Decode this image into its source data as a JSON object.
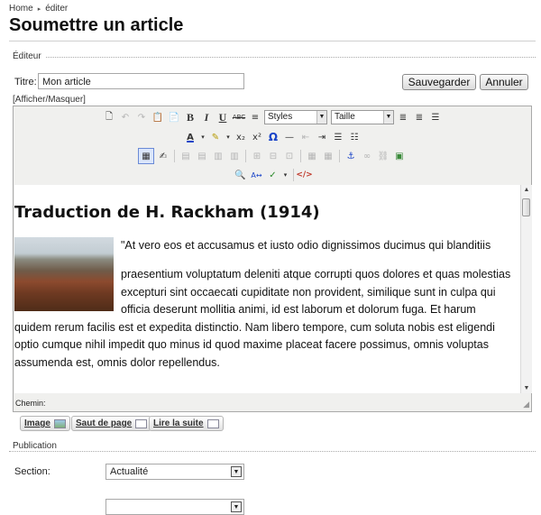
{
  "breadcrumb": {
    "home": "Home",
    "current": "éditer"
  },
  "page_title": "Soumettre un article",
  "editor_section": {
    "legend": "Éditeur",
    "title_label": "Titre:",
    "title_value": "Mon article",
    "save_label": "Sauvegarder",
    "cancel_label": "Annuler",
    "toggle_label": "[Afficher/Masquer]"
  },
  "toolbar": {
    "styles_value": "Styles",
    "size_value": "Taille",
    "icons_row1": [
      "new-document-icon",
      "undo-icon",
      "redo-icon",
      "paste-text-icon",
      "paste-word-icon",
      "bold-icon",
      "italic-icon",
      "underline-icon",
      "strikethrough-icon",
      "align-justify-icon",
      "align-left-icon",
      "align-right-icon",
      "align-full-icon"
    ],
    "icons_row2": [
      "text-color-icon",
      "highlight-color-icon",
      "subscript-icon",
      "superscript-icon",
      "special-character-icon",
      "horizontal-rule-icon",
      "outdent-icon",
      "indent-icon",
      "bullet-list-icon",
      "numbered-list-icon"
    ],
    "icons_row3": [
      "insert-table-icon",
      "table-properties-icon",
      "anchor-icon",
      "link-icon",
      "unlink-icon",
      "insert-image-icon"
    ],
    "icons_row4": [
      "find-icon",
      "replace-icon",
      "spellcheck-icon",
      "html-source-icon"
    ]
  },
  "content": {
    "heading": "Traduction de H. Rackham (1914)",
    "para1": "\"At vero eos et accusamus et iusto odio dignissimos ducimus qui blanditiis",
    "para2_lines": [
      "praesentium voluptatum deleniti atque corrupti quos dolores et quas molestias",
      "excepturi sint occaecati cupiditate non provident, similique sunt in culpa qui",
      "officia deserunt mollitia animi, id est laborum et dolorum fuga. Et harum",
      "quidem rerum facilis est et expedita distinctio. Nam libero tempore, cum soluta nobis est eligendi",
      "optio cumque nihil impedit quo minus id quod maxime placeat facere possimus, omnis voluptas",
      "assumenda est, omnis dolor repellendus."
    ]
  },
  "status_bar": {
    "path_label": "Chemin:"
  },
  "extra_buttons": {
    "image": "Image",
    "page_break": "Saut de page",
    "read_more": "Lire la suite"
  },
  "publication": {
    "legend": "Publication",
    "section_label": "Section:",
    "section_value": "Actualité"
  }
}
